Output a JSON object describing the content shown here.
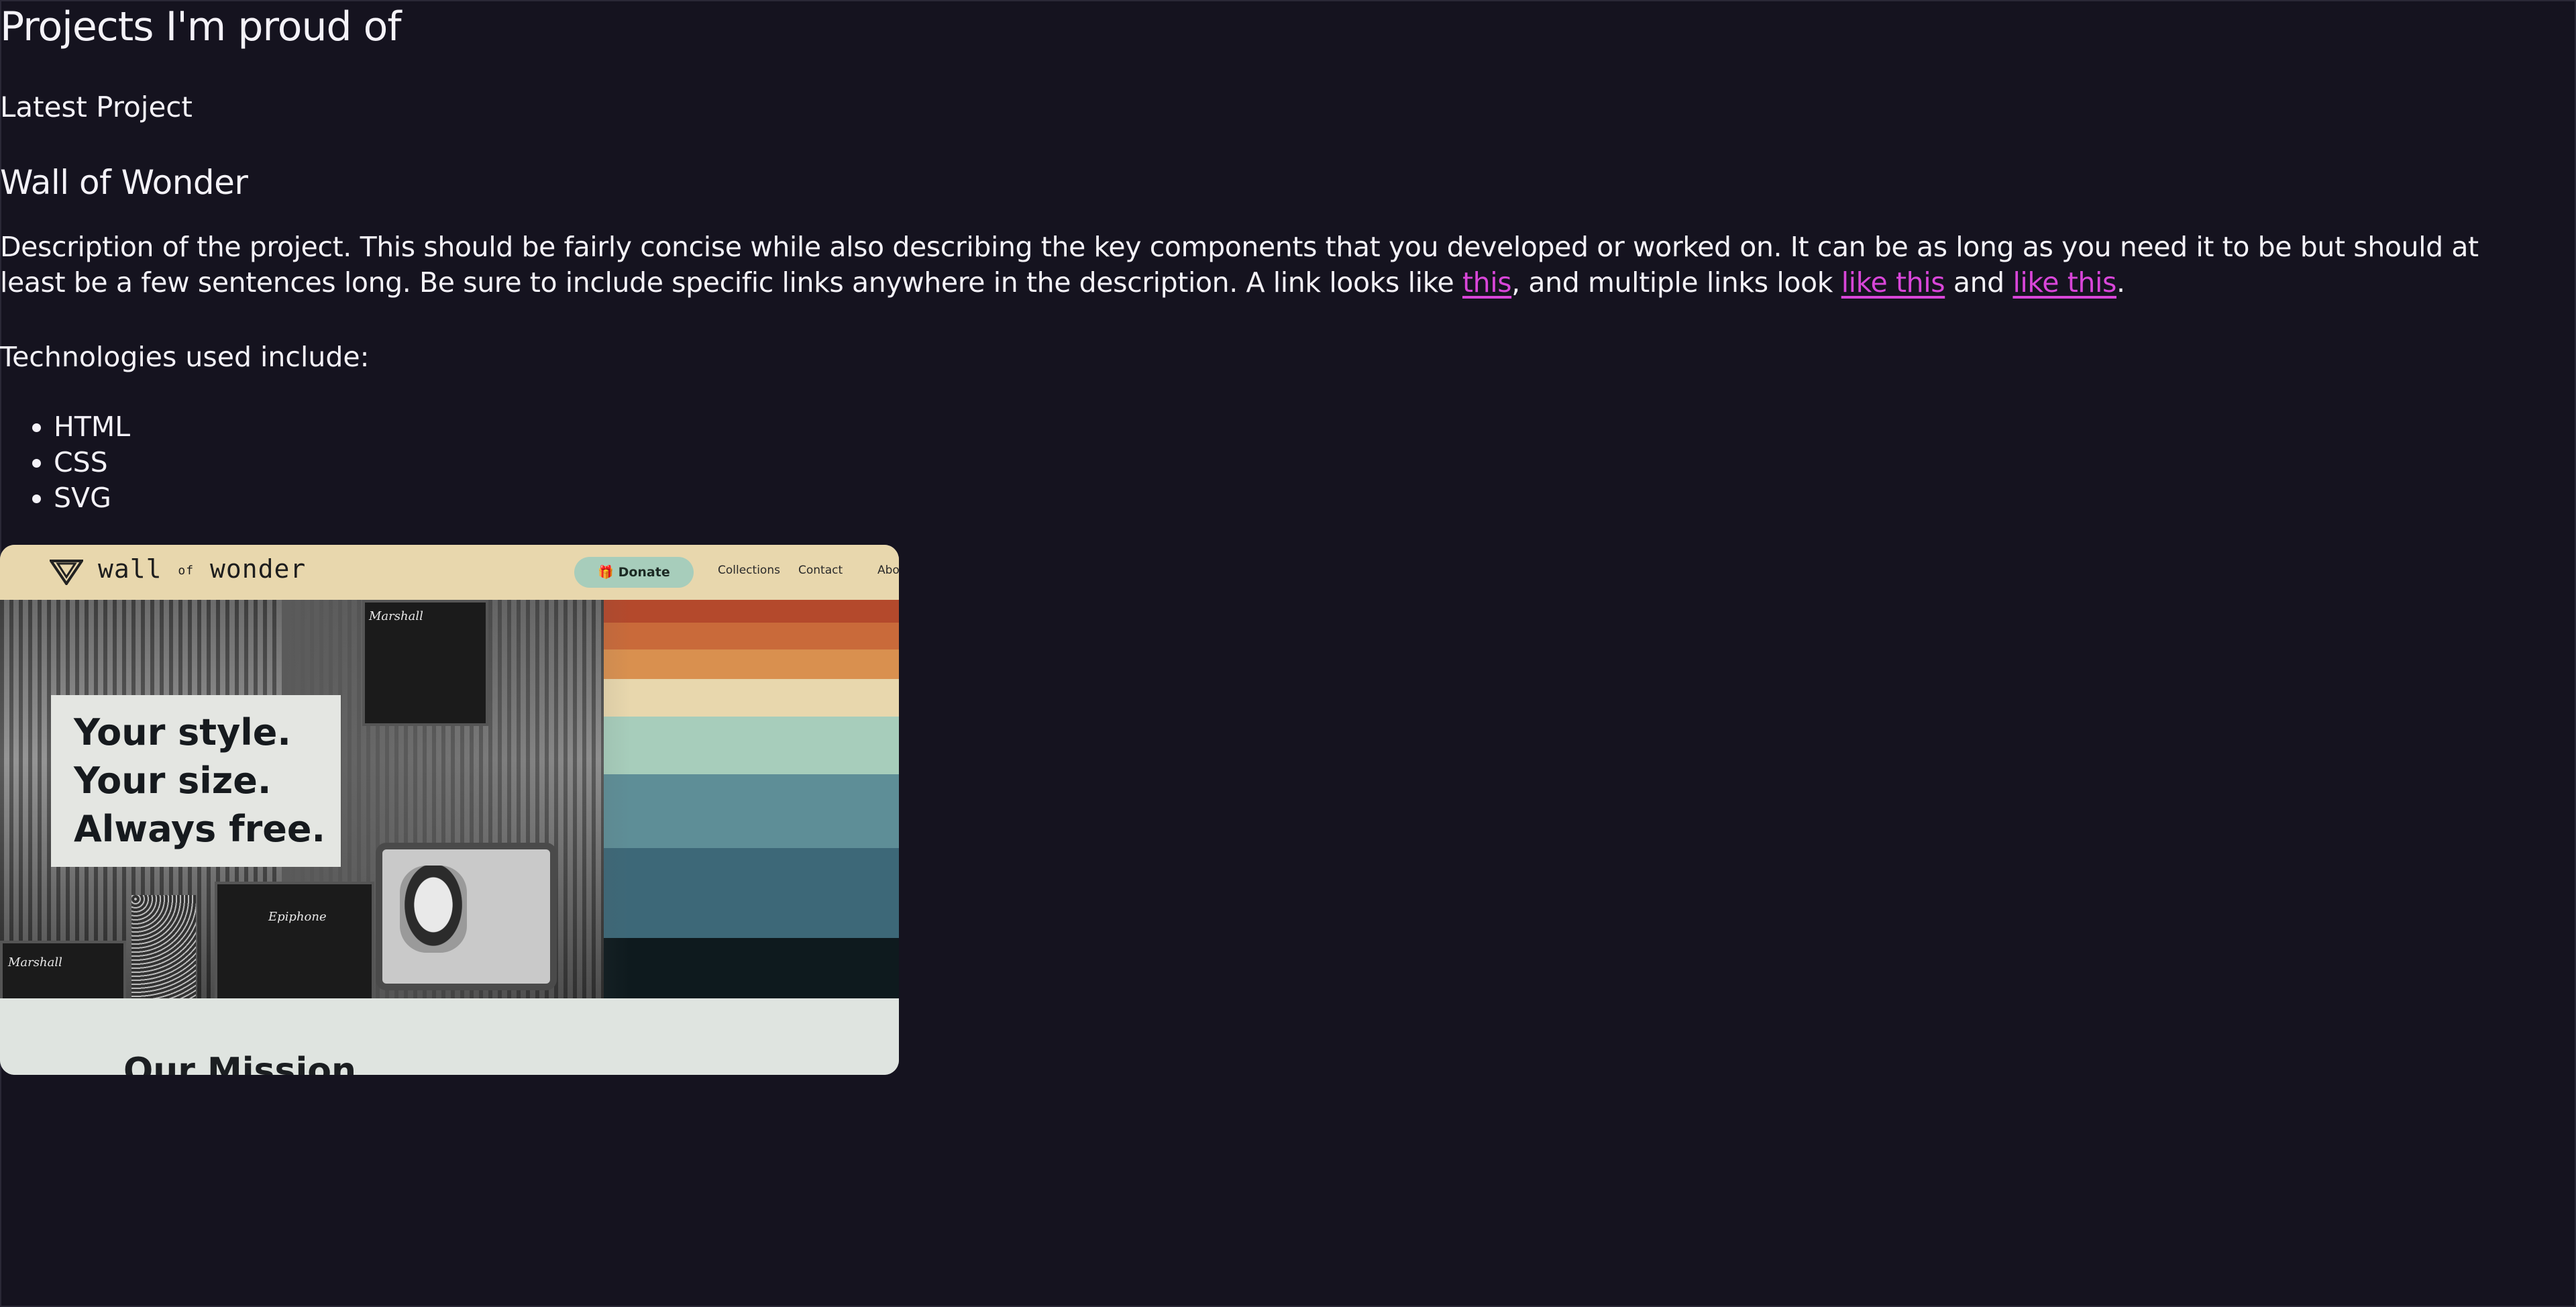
{
  "page": {
    "title": "Projects I'm proud of",
    "section_label": "Latest Project"
  },
  "project": {
    "name": "Wall of Wonder",
    "description": {
      "part1": "Description of the project. This should be fairly concise while also describing the key components that you developed or worked on. It can be as long as you need it to be but should at least be a few sentences long. Be sure to include specific links anywhere in the description. A link looks like ",
      "link1": "this",
      "part2": ", and multiple links look ",
      "link2": "like this",
      "part3": " and ",
      "link3": "like this",
      "part4": "."
    },
    "tech_label": "Technologies used include:",
    "technologies": [
      "HTML",
      "CSS",
      "SVG"
    ]
  },
  "screenshot": {
    "logo_text_a": "wall",
    "logo_text_b": "of",
    "logo_text_c": "wonder",
    "donate_label": "Donate",
    "nav_links": [
      "Collections",
      "Contact",
      "Abo"
    ],
    "tagline": [
      "Your style.",
      "Your size.",
      "Always free."
    ],
    "mission_heading": "Our Mission",
    "brand_marks": [
      "Marshall",
      "Marshall",
      "Epiphone"
    ]
  },
  "colors": {
    "background": "#15131f",
    "text": "#f4f2f8",
    "link": "#d946d9",
    "stripes": [
      "#b4492c",
      "#c96a3a",
      "#d9904f",
      "#e8d7ad",
      "#a7cdbb",
      "#5e8e97",
      "#3d6878",
      "#0e1a1e"
    ]
  }
}
